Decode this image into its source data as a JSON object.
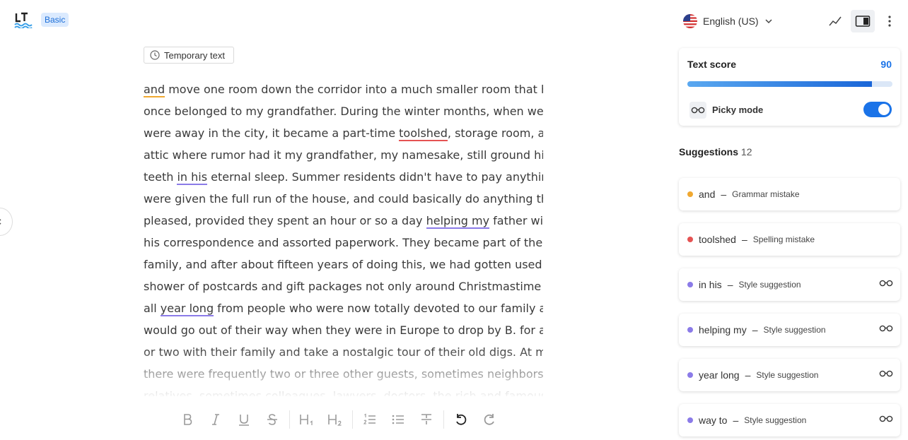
{
  "header": {
    "badge": "Basic",
    "language": "English (US)"
  },
  "editor": {
    "temp_chip": "Temporary text",
    "lines": [
      [
        {
          "t": "and",
          "m": "orange"
        },
        {
          "t": " move one room down the corridor into a much smaller room that had"
        }
      ],
      [
        {
          "t": "once belonged to my grandfather. During the winter months, when we"
        }
      ],
      [
        {
          "t": "were away in the city, it became a part-time "
        },
        {
          "t": "toolshed",
          "m": "red"
        },
        {
          "t": ", storage room, and"
        }
      ],
      [
        {
          "t": "attic where rumor had it my grandfather, my namesake, still ground his"
        }
      ],
      [
        {
          "t": "teeth "
        },
        {
          "t": "in his",
          "m": "purple"
        },
        {
          "t": " eternal sleep. Summer residents didn't have to pay anything,"
        }
      ],
      [
        {
          "t": "were given the full run of the house, and could basically do anything they"
        }
      ],
      [
        {
          "t": "pleased, provided they spent an hour or so a day "
        },
        {
          "t": "helping my",
          "m": "purple"
        },
        {
          "t": " father with"
        }
      ],
      [
        {
          "t": "his correspondence and assorted paperwork. They became part of the"
        }
      ],
      [
        {
          "t": "family, and after about fifteen years of doing this, we had gotten used to a"
        }
      ],
      [
        {
          "t": "shower of postcards and gift packages not only around Christmastime but"
        }
      ],
      [
        {
          "t": "all "
        },
        {
          "t": "year long",
          "m": "purple"
        },
        {
          "t": " from people who were now totally devoted to our family and"
        }
      ],
      [
        {
          "t": "would go out of their way when they were in Europe to drop by B. for a day"
        }
      ],
      [
        {
          "t": "or two with their family and take a nostalgic tour of their old digs. At meals"
        }
      ],
      [
        {
          "t": "there were frequently two or three other guests, sometimes neighbors or"
        }
      ],
      [
        {
          "t": "relatives, sometimes colleagues, lawyers, doctors, the rich and famous"
        }
      ]
    ]
  },
  "score": {
    "title": "Text score",
    "value": "90",
    "fill_percent": 90,
    "picky_label": "Picky mode",
    "picky_on": true
  },
  "suggestions": {
    "title": "Suggestions",
    "count": "12",
    "items": [
      {
        "word": "and",
        "type": "Grammar mistake",
        "color": "#f0a830",
        "picky": false
      },
      {
        "word": "toolshed",
        "type": "Spelling mistake",
        "color": "#e55353",
        "picky": false
      },
      {
        "word": "in his",
        "type": "Style suggestion",
        "color": "#8b7be8",
        "picky": true
      },
      {
        "word": "helping my",
        "type": "Style suggestion",
        "color": "#8b7be8",
        "picky": true
      },
      {
        "word": "year long",
        "type": "Style suggestion",
        "color": "#8b7be8",
        "picky": true
      },
      {
        "word": "way to",
        "type": "Style suggestion",
        "color": "#8b7be8",
        "picky": true
      }
    ]
  },
  "icons": {
    "toolbar": [
      "bold-icon",
      "italic-icon",
      "underline-icon",
      "strikethrough-icon",
      "heading1-icon",
      "heading2-icon",
      "ordered-list-icon",
      "bullet-list-icon",
      "clear-format-icon",
      "undo-icon",
      "redo-icon"
    ]
  }
}
